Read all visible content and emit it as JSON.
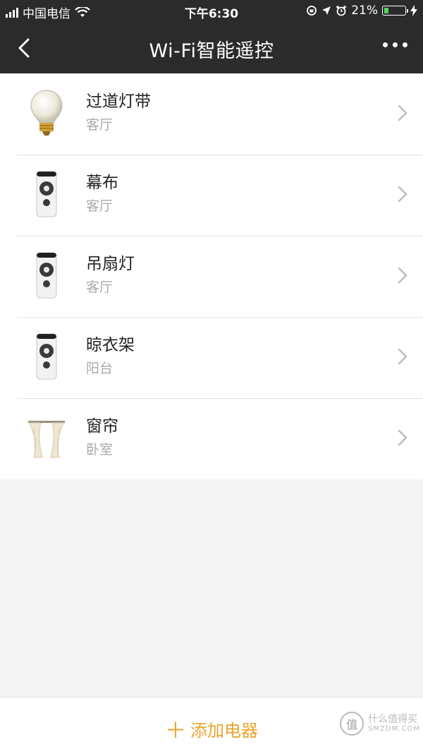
{
  "status": {
    "carrier": "中国电信",
    "time": "下午6:30",
    "battery_text": "21%",
    "battery_level": 0.21,
    "battery_color": "#4cd964"
  },
  "navbar": {
    "title": "Wi-Fi智能遥控",
    "back_icon": "chevron-left-icon",
    "more_icon": "more-dots-icon"
  },
  "devices": [
    {
      "name": "过道灯带",
      "room": "客厅",
      "icon": "light-bulb-icon"
    },
    {
      "name": "幕布",
      "room": "客厅",
      "icon": "remote-control-icon"
    },
    {
      "name": "吊扇灯",
      "room": "客厅",
      "icon": "remote-control-icon"
    },
    {
      "name": "晾衣架",
      "room": "阳台",
      "icon": "remote-control-icon"
    },
    {
      "name": "窗帘",
      "room": "卧室",
      "icon": "curtain-icon"
    }
  ],
  "bottom": {
    "add_plus": "＋",
    "add_label": "添加电器",
    "accent": "#e9a52c"
  },
  "watermark": {
    "badge": "值",
    "line1": "什么值得买",
    "line2": "SMZDM.COM"
  }
}
